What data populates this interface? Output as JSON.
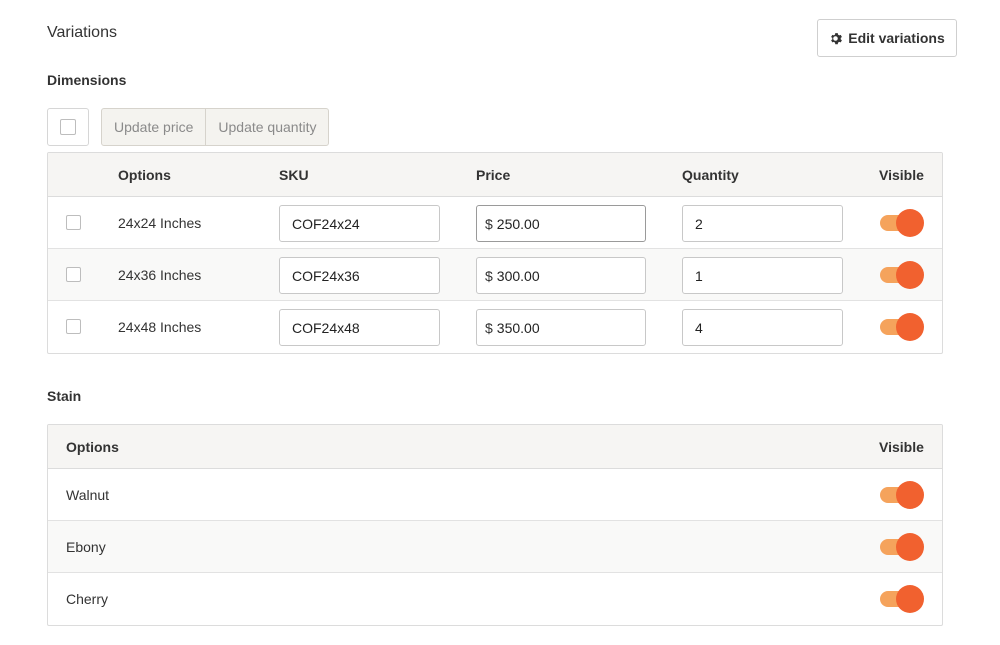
{
  "page": {
    "title": "Variations",
    "edit_button": "Edit variations"
  },
  "dimensions": {
    "label": "Dimensions",
    "bulk": {
      "update_price": "Update price",
      "update_quantity": "Update quantity"
    },
    "columns": {
      "options": "Options",
      "sku": "SKU",
      "price": "Price",
      "quantity": "Quantity",
      "visible": "Visible"
    },
    "currency_symbol": "$",
    "rows": [
      {
        "option": "24x24 Inches",
        "sku": "COF24x24",
        "price": "250.00",
        "quantity": "2",
        "visible": true
      },
      {
        "option": "24x36 Inches",
        "sku": "COF24x36",
        "price": "300.00",
        "quantity": "1",
        "visible": true
      },
      {
        "option": "24x48 Inches",
        "sku": "COF24x48",
        "price": "350.00",
        "quantity": "4",
        "visible": true
      }
    ]
  },
  "stain": {
    "label": "Stain",
    "columns": {
      "options": "Options",
      "visible": "Visible"
    },
    "rows": [
      {
        "option": "Walnut",
        "visible": true
      },
      {
        "option": "Ebony",
        "visible": true
      },
      {
        "option": "Cherry",
        "visible": true
      }
    ]
  },
  "colors": {
    "toggle_track": "#f5a35c",
    "toggle_knob": "#f1612f"
  },
  "icons": {
    "edit_button": "gear-icon"
  }
}
